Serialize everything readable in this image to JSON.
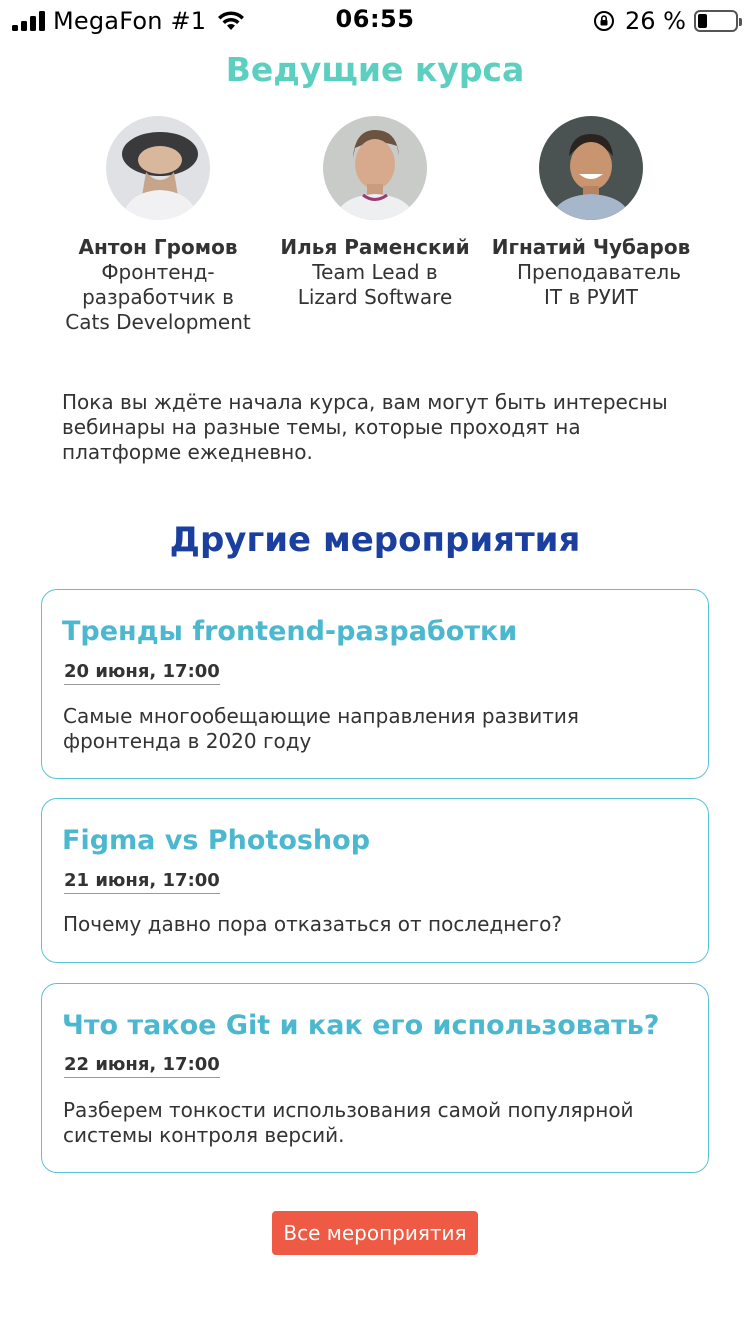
{
  "status_bar": {
    "carrier": "MegaFon #1",
    "time": "06:55",
    "battery_percent": "26 %",
    "battery_level": 0.26
  },
  "leaders": {
    "title": "Ведущие курса",
    "items": [
      {
        "name": "Антон Громов",
        "role": "Фронтенд-разработчик в Cats Development"
      },
      {
        "name": "Илья Раменский",
        "role": "Team Lead в Lizard Software"
      },
      {
        "name": "Игнатий Чубаров",
        "role": "Преподаватель IT в РУИТ"
      }
    ]
  },
  "intro_text": "Пока вы ждёте начала курса, вам могут быть интересны вебинары на разные темы, которые проходят на платформе ежедневно.",
  "events": {
    "title": "Другие мероприятия",
    "items": [
      {
        "title": "Тренды frontend-разработки",
        "date": "20 июня, 17:00",
        "description": "Самые многообещающие направления развития фронтенда в 2020 году"
      },
      {
        "title": "Figma vs Photoshop",
        "date": "21 июня, 17:00",
        "description": "Почему давно пора отказаться от последнего?"
      },
      {
        "title": "Что такое Git и как его использовать?",
        "date": "22 июня, 17:00",
        "description": "Разберем тонкости использования самой популярной системы контроля версий."
      }
    ],
    "all_button_label": "Все мероприятия"
  },
  "colors": {
    "leaders_title": "#5ccfc0",
    "events_title": "#1a3f9e",
    "card_border": "#5bc2d3",
    "event_title": "#4bb8d0",
    "button_bg": "#ee5a43"
  }
}
